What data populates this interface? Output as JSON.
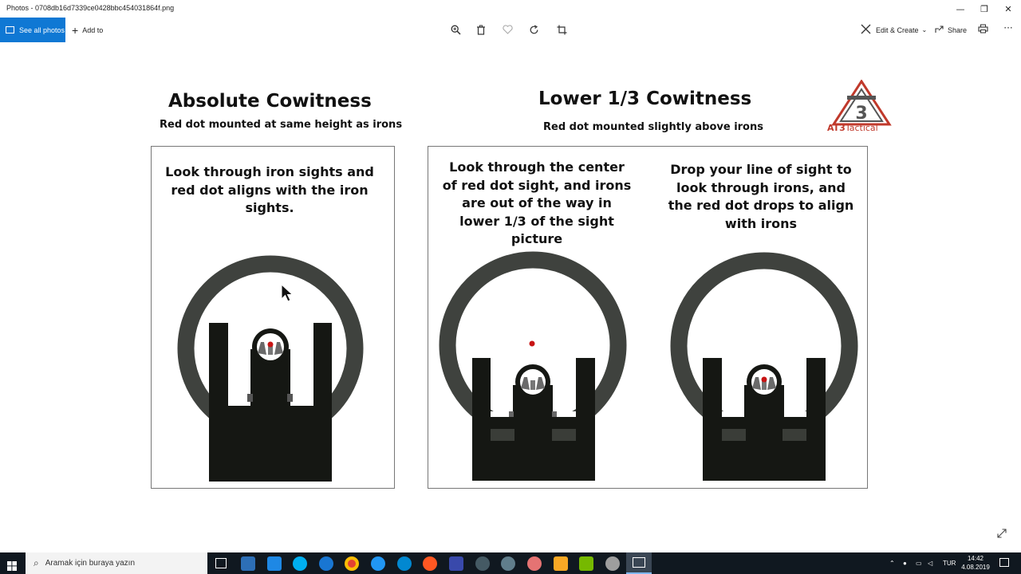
{
  "window": {
    "title": "Photos - 0708db16d7339ce0428bbc454031864f.png",
    "controls": {
      "minimize": "—",
      "restore": "❐",
      "close": "✕"
    }
  },
  "toolbar": {
    "see_all_photos": "See all photos",
    "add_to": "Add to",
    "zoom_icon": "zoom-icon",
    "delete_icon": "trash-icon",
    "favorite_icon": "heart-icon",
    "rotate_icon": "rotate-icon",
    "crop_icon": "crop-icon",
    "edit_create": "Edit & Create",
    "share": "Share",
    "print_icon": "printer-icon",
    "more": "···",
    "accent": "#0f78d4"
  },
  "image": {
    "left_title": "Absolute Cowitness",
    "left_subtitle": "Red dot mounted at same height as irons",
    "right_title": "Lower 1/3 Cowitness",
    "right_subtitle": "Red dot mounted slightly above irons",
    "logo_brand_a": "AT3",
    "logo_brand_b": "Tactical",
    "logo_mark": "3",
    "caption_1": "Look through iron sights and red dot aligns with the iron sights.",
    "caption_2": "Look through the center of red dot sight, and irons are out of the way in lower 1/3 of the sight picture",
    "caption_3": "Drop your line of sight to look through irons, and the red dot drops to align with irons",
    "colors": {
      "ring": "#3f423e",
      "iron": "#151713",
      "dot": "#c81414",
      "panel_border": "#777777",
      "logo_red": "#c0392b"
    }
  },
  "taskbar": {
    "search_placeholder": "Aramak için buraya yazın",
    "language": "TUR",
    "time": "14:42",
    "date": "4.08.2019"
  }
}
